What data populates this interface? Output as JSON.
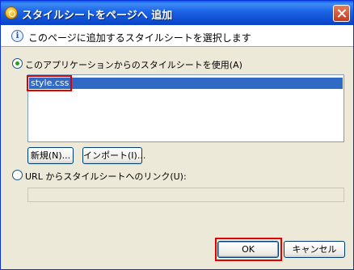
{
  "window": {
    "title": "スタイルシートをページへ 追加"
  },
  "banner": {
    "text": "このページに追加するスタイルシートを選択します"
  },
  "options": {
    "app_radio_label": "このアプリケーションからのスタイルシートを使用(A)",
    "app_radio_checked": true,
    "url_radio_label": "URL からスタイルシートへのリンク(U):",
    "url_radio_checked": false
  },
  "stylesheet_list": {
    "items": [
      "style.css"
    ],
    "selected_index": 0
  },
  "buttons": {
    "new_label": "新規(N)...",
    "import_label": "インポート(I)...",
    "ok_label": "OK",
    "cancel_label": "キャンセル"
  },
  "url_field": {
    "value": ""
  },
  "colors": {
    "titlebar": "#0842c6",
    "selection": "#316ac5",
    "highlight_box": "#e00000"
  }
}
